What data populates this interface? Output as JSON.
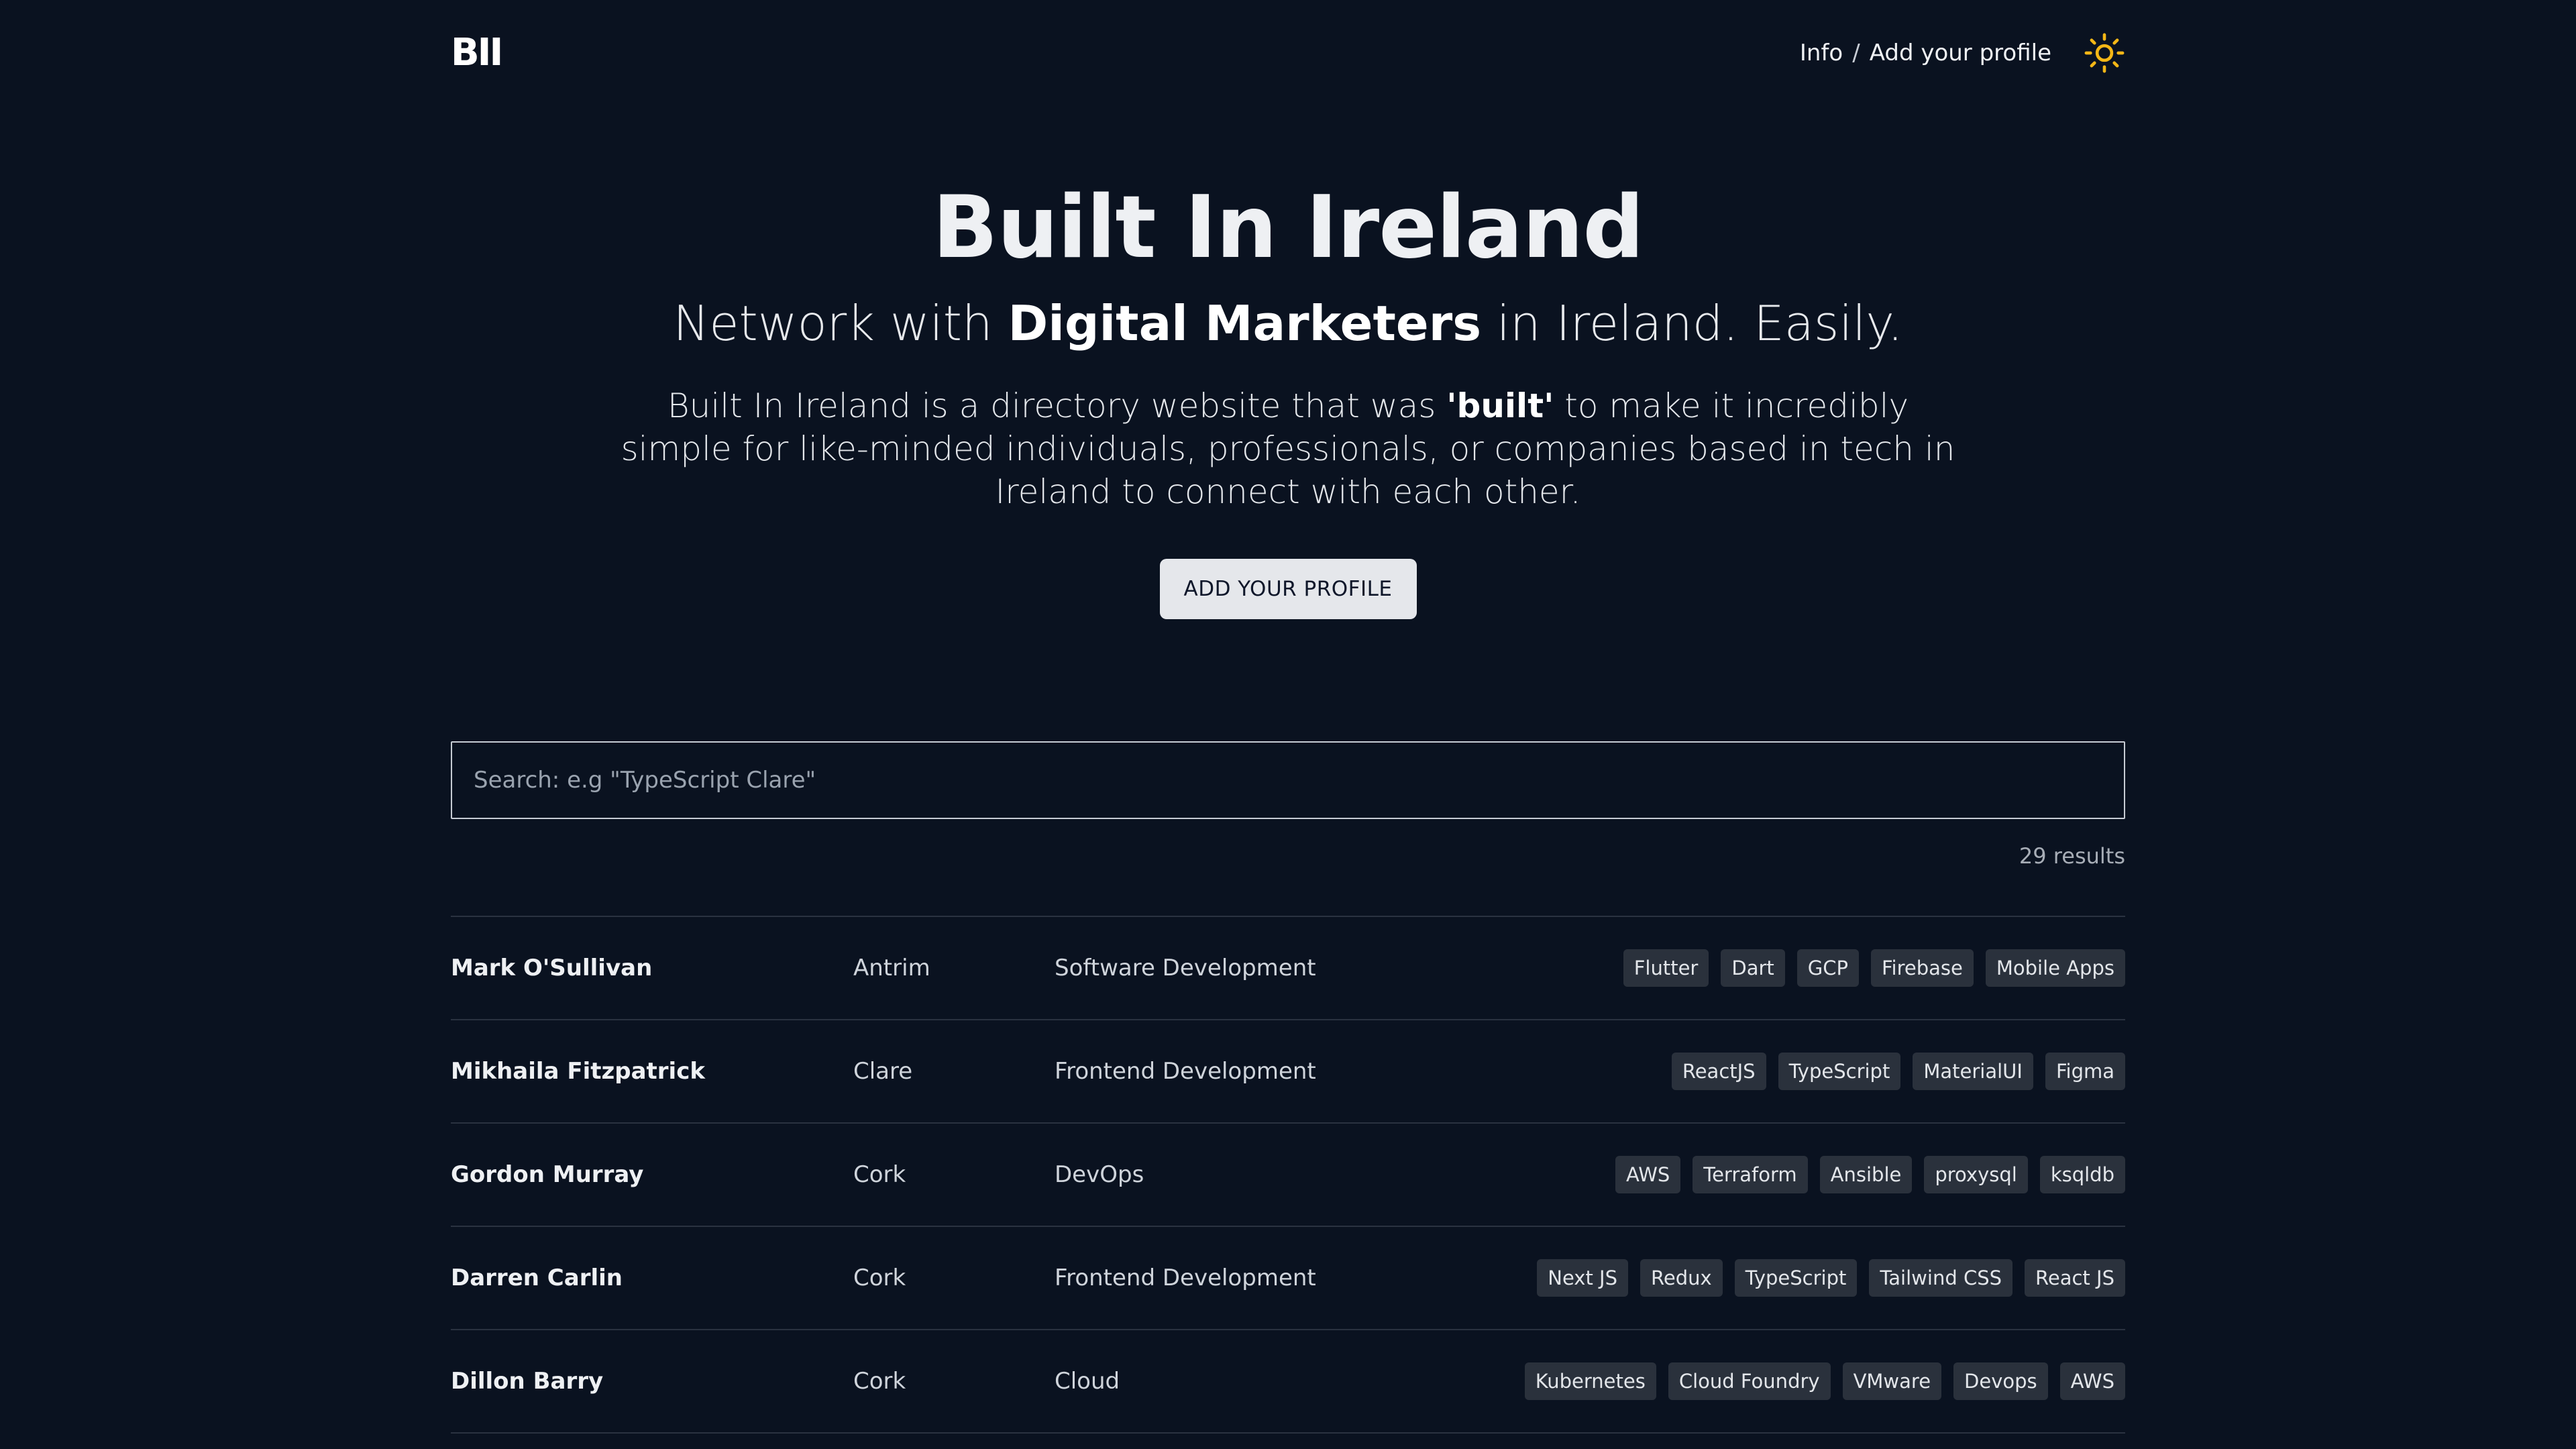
{
  "header": {
    "logo": "BII",
    "nav_info": "Info",
    "nav_sep": "/",
    "nav_add": "Add your profile",
    "theme_icon": "sun-icon"
  },
  "hero": {
    "title": "Built In Ireland",
    "subtitle_pre": "Network with ",
    "subtitle_bold": "Digital Marketers",
    "subtitle_post": " in Ireland. Easily.",
    "desc_pre": "Built In Ireland is a directory website that was ",
    "desc_bold": "'built'",
    "desc_post": " to make it incredibly simple for like-minded individuals, professionals, or companies based in tech in Ireland to connect with each other.",
    "cta": "ADD YOUR PROFILE"
  },
  "search": {
    "placeholder": "Search: e.g \"TypeScript Clare\"",
    "results": "29 results"
  },
  "profiles": [
    {
      "name": "Mark O'Sullivan",
      "location": "Antrim",
      "category": "Software Development",
      "tags": [
        "Flutter",
        "Dart",
        "GCP",
        "Firebase",
        "Mobile Apps"
      ]
    },
    {
      "name": "Mikhaila Fitzpatrick",
      "location": "Clare",
      "category": "Frontend Development",
      "tags": [
        "ReactJS",
        "TypeScript",
        "MaterialUI",
        "Figma"
      ]
    },
    {
      "name": "Gordon Murray",
      "location": "Cork",
      "category": "DevOps",
      "tags": [
        "AWS",
        "Terraform",
        "Ansible",
        "proxysql",
        "ksqldb"
      ]
    },
    {
      "name": "Darren Carlin",
      "location": "Cork",
      "category": "Frontend Development",
      "tags": [
        "Next JS",
        "Redux",
        "TypeScript",
        "Tailwind CSS",
        "React JS"
      ]
    },
    {
      "name": "Dillon Barry",
      "location": "Cork",
      "category": "Cloud",
      "tags": [
        "Kubernetes",
        "Cloud Foundry",
        "VMware",
        "Devops",
        "AWS"
      ]
    }
  ],
  "colors": {
    "background": "#0a1220",
    "accent_sun": "#f5b716",
    "tag_bg": "#2a313c"
  }
}
